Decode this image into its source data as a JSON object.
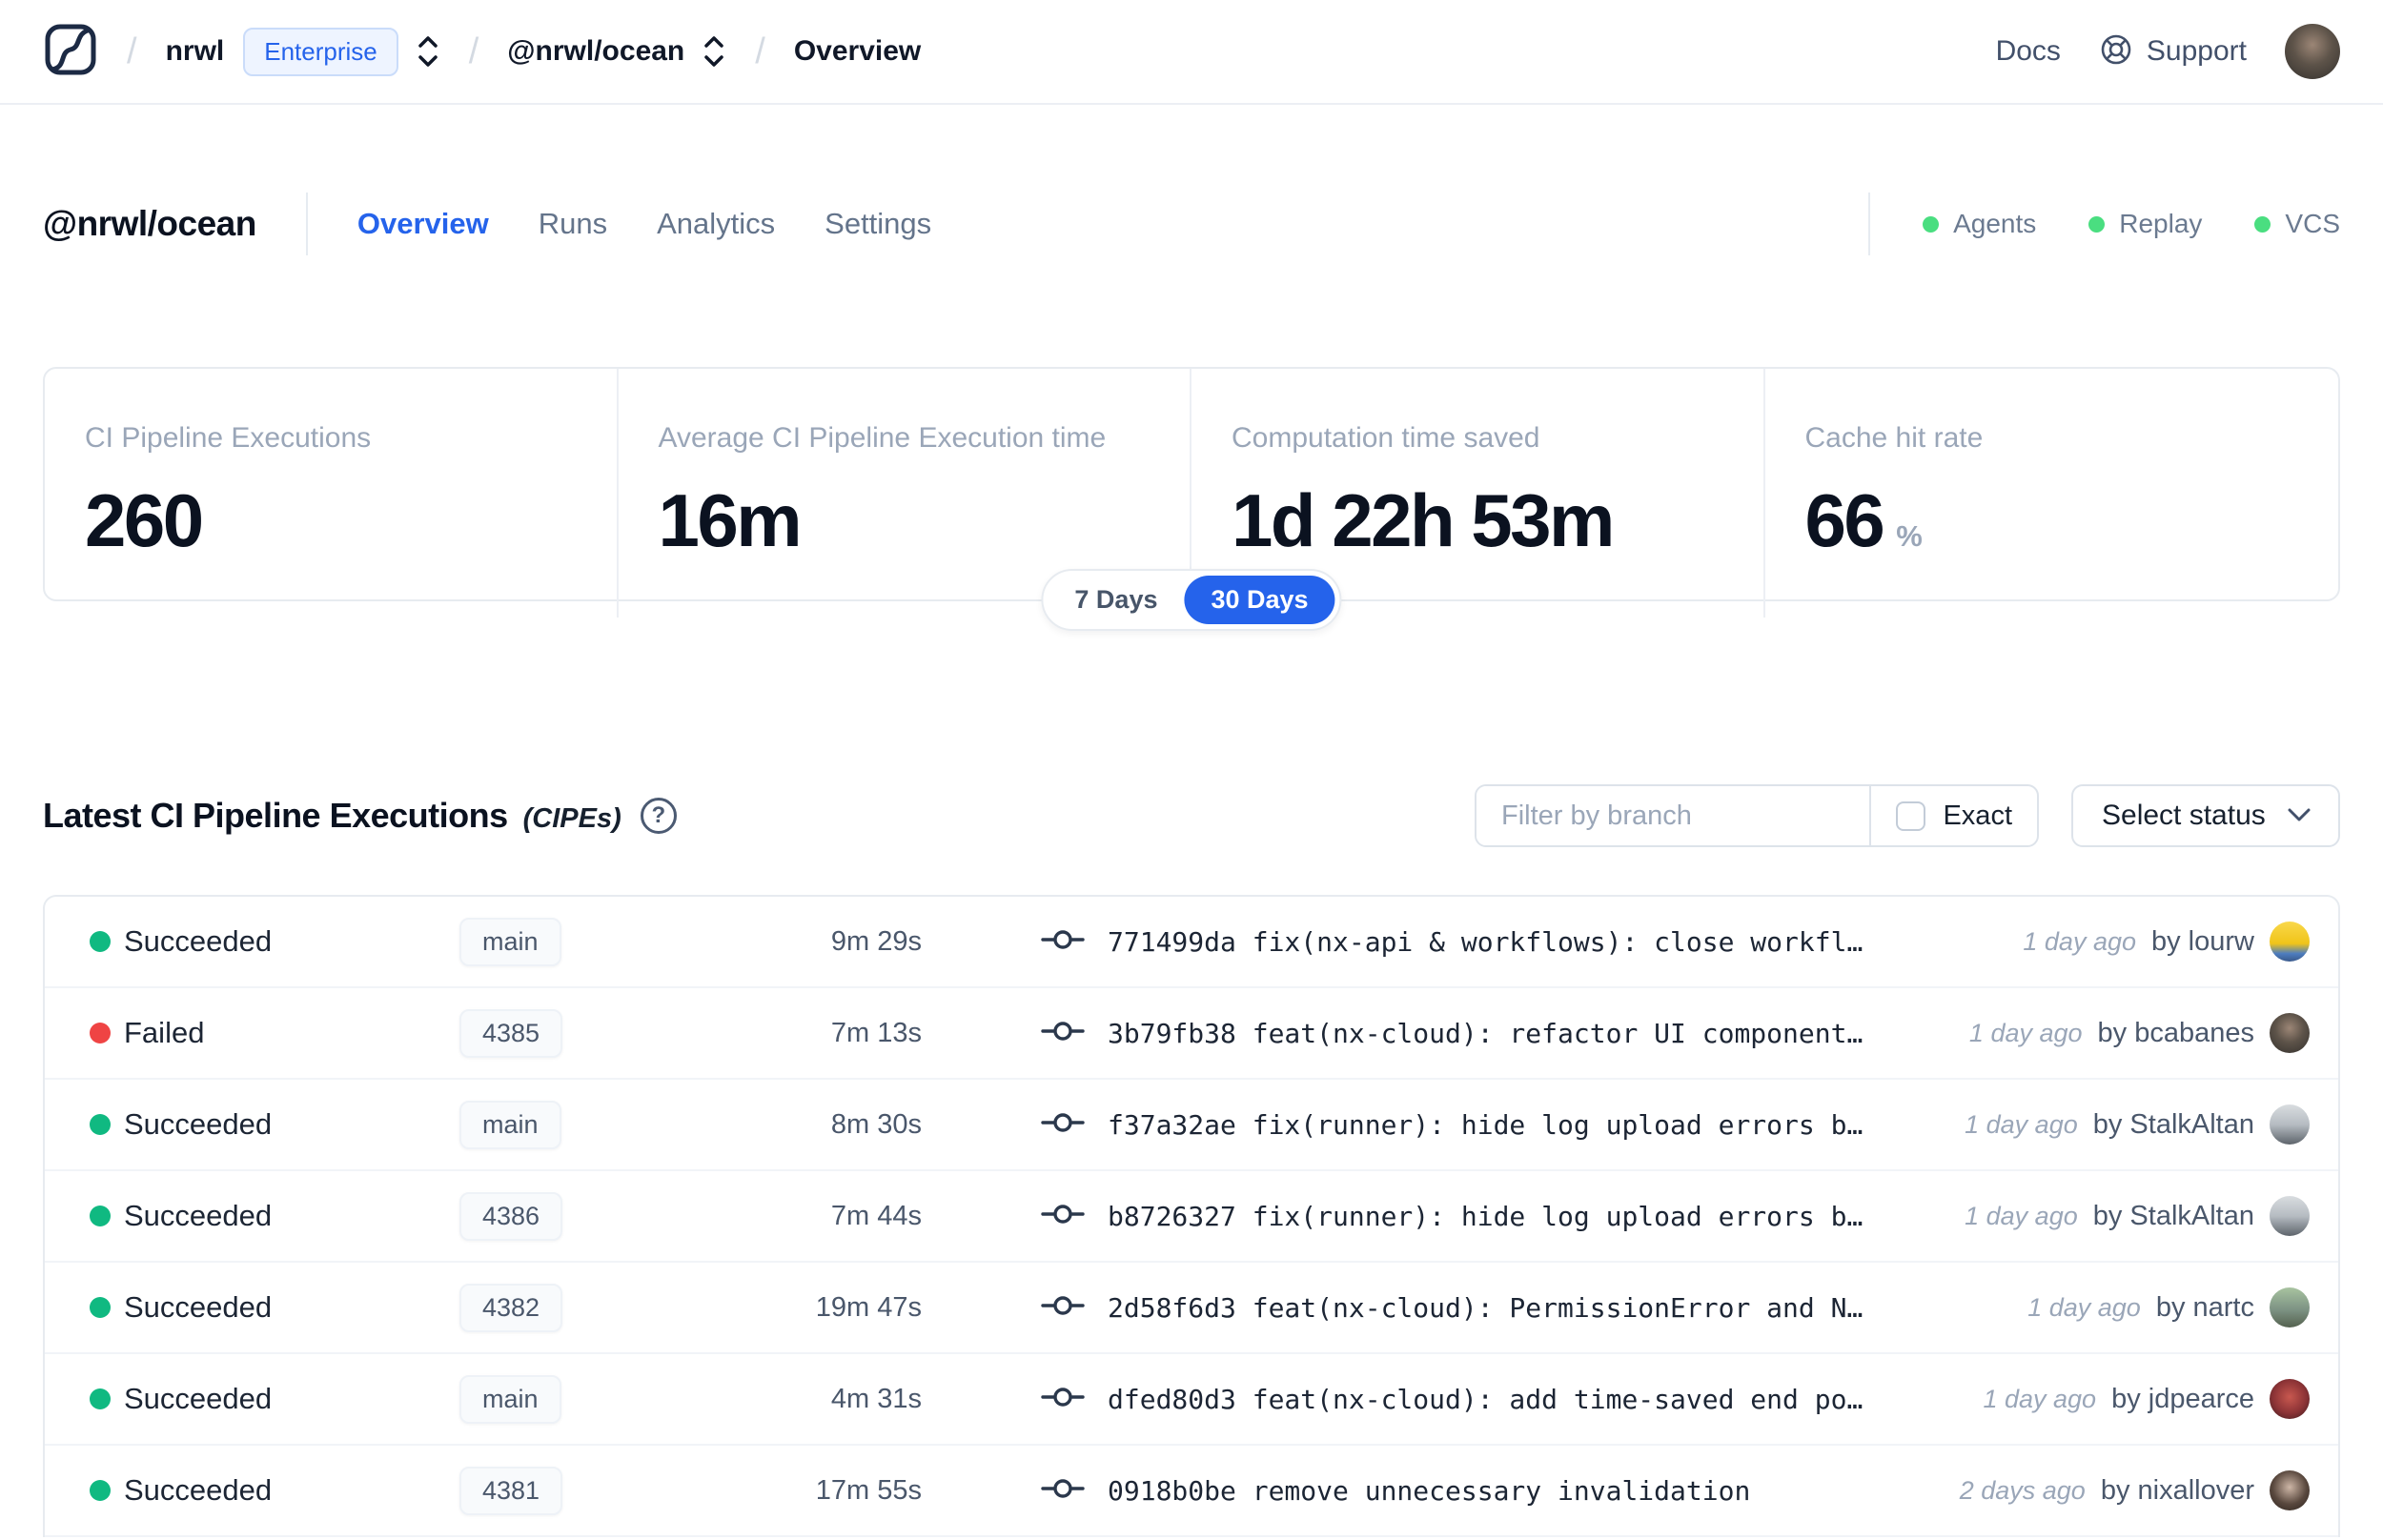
{
  "navbar": {
    "separator": "/",
    "org": "nrwl",
    "org_badge": "Enterprise",
    "workspace": "@nrwl/ocean",
    "page": "Overview",
    "docs": "Docs",
    "support": "Support"
  },
  "workspace_header": {
    "title": "@nrwl/ocean",
    "tabs": [
      {
        "label": "Overview",
        "state": "active"
      },
      {
        "label": "Runs",
        "state": ""
      },
      {
        "label": "Analytics",
        "state": ""
      },
      {
        "label": "Settings",
        "state": ""
      }
    ],
    "indicators": [
      {
        "label": "Agents"
      },
      {
        "label": "Replay"
      },
      {
        "label": "VCS"
      }
    ]
  },
  "stats": {
    "cards": [
      {
        "label": "CI Pipeline Executions",
        "value": "260"
      },
      {
        "label": "Average CI Pipeline Execution time",
        "value": "16m"
      },
      {
        "label": "Computation time saved",
        "value": "1d 22h 53m"
      },
      {
        "label": "Cache hit rate",
        "value": "66",
        "suffix": "%"
      }
    ],
    "period_options": [
      "7 Days",
      "30 Days"
    ],
    "period_selected": "30 Days"
  },
  "cipe": {
    "title": "Latest CI Pipeline Executions",
    "title_suffix": "(CIPEs)",
    "help": "?",
    "filter": {
      "placeholder": "Filter by branch",
      "exact_label": "Exact",
      "status_label": "Select status"
    },
    "rows": [
      {
        "status": "Succeeded",
        "status_color": "green",
        "branch": "main",
        "duration": "9m 29s",
        "commit": "771499da fix(nx-api & workflows): close workfl…",
        "time": "1 day ago",
        "author": "by lourw",
        "avatar_style": "background:linear-gradient(180deg,#f9d84b 0%,#f0c419 55%,#4d7dbf 80%,#3a5a8c 100%)"
      },
      {
        "status": "Failed",
        "status_color": "red",
        "branch": "4385",
        "duration": "7m 13s",
        "commit": "3b79fb38 feat(nx-cloud): refactor UI component…",
        "time": "1 day ago",
        "author": "by bcabanes",
        "avatar_style": "background:radial-gradient(circle at 50% 38%,#9c8676 0%,#5d5349 45%,#33302d 100%)"
      },
      {
        "status": "Succeeded",
        "status_color": "green",
        "branch": "main",
        "duration": "8m 30s",
        "commit": "f37a32ae fix(runner): hide log upload errors b…",
        "time": "1 day ago",
        "author": "by StalkAltan",
        "avatar_style": "background:linear-gradient(180deg,#d9dde0 0%,#b6bcc2 50%,#5d646b 100%)"
      },
      {
        "status": "Succeeded",
        "status_color": "green",
        "branch": "4386",
        "duration": "7m 44s",
        "commit": "b8726327 fix(runner): hide log upload errors b…",
        "time": "1 day ago",
        "author": "by StalkAltan",
        "avatar_style": "background:linear-gradient(180deg,#d9dde0 0%,#b6bcc2 50%,#5d646b 100%)"
      },
      {
        "status": "Succeeded",
        "status_color": "green",
        "branch": "4382",
        "duration": "19m 47s",
        "commit": "2d58f6d3 feat(nx-cloud): PermissionError and N…",
        "time": "1 day ago",
        "author": "by nartc",
        "avatar_style": "background:linear-gradient(180deg,#a8c3a0 0%,#7d9384 55%,#55624f 100%)"
      },
      {
        "status": "Succeeded",
        "status_color": "green",
        "branch": "main",
        "duration": "4m 31s",
        "commit": "dfed80d3 feat(nx-cloud): add time-saved end po…",
        "time": "1 day ago",
        "author": "by jdpearce",
        "avatar_style": "background:radial-gradient(circle at 50% 45%,#c8584f 0%,#8c3336 55%,#351a1c 100%)"
      },
      {
        "status": "Succeeded",
        "status_color": "green",
        "branch": "4381",
        "duration": "17m 55s",
        "commit": "0918b0be remove unnecessary invalidation",
        "time": "2 days ago",
        "author": "by nixallover",
        "avatar_style": "background:radial-gradient(circle at 50% 42%,#cdb6a6 0%,#59483e 55%,#2a211c 100%)"
      }
    ]
  },
  "colors": {
    "accent_blue": "#2563eb",
    "success_green": "#10b981",
    "failed_red": "#ef4444",
    "indicator_green": "#4ade80"
  }
}
